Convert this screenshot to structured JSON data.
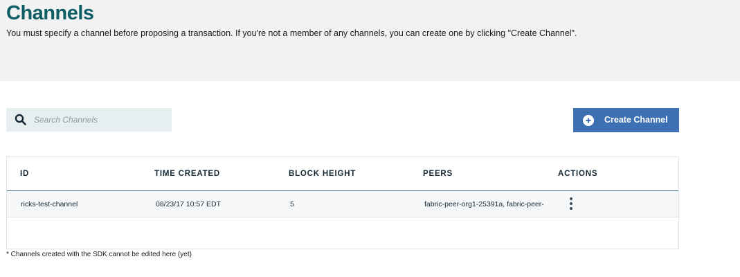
{
  "header": {
    "title": "Channels",
    "description": "You must specify a channel before proposing a transaction. If you're not a member of any channels, you can create one by clicking \"Create Channel\"."
  },
  "search": {
    "placeholder": "Search Channels",
    "value": ""
  },
  "create_button": {
    "label": "Create Channel",
    "icon": "plus-circle-icon",
    "color": "#3d70b2"
  },
  "table": {
    "columns": [
      "ID",
      "TIME CREATED",
      "BLOCK HEIGHT",
      "PEERS",
      "ACTIONS"
    ],
    "rows": [
      {
        "id": "ricks-test-channel",
        "time_created": "08/23/17 10:57 EDT",
        "block_height": "5",
        "peers": "fabric-peer-org1-25391a, fabric-peer-",
        "actions_icon": "overflow-menu-icon"
      }
    ]
  },
  "footnote": "* Channels created with the SDK cannot be edited here (yet)",
  "colors": {
    "title": "#0f5d65",
    "header_band": "#f2f2f2",
    "search_bg": "#e6eef0",
    "accent": "#3d70b2"
  }
}
